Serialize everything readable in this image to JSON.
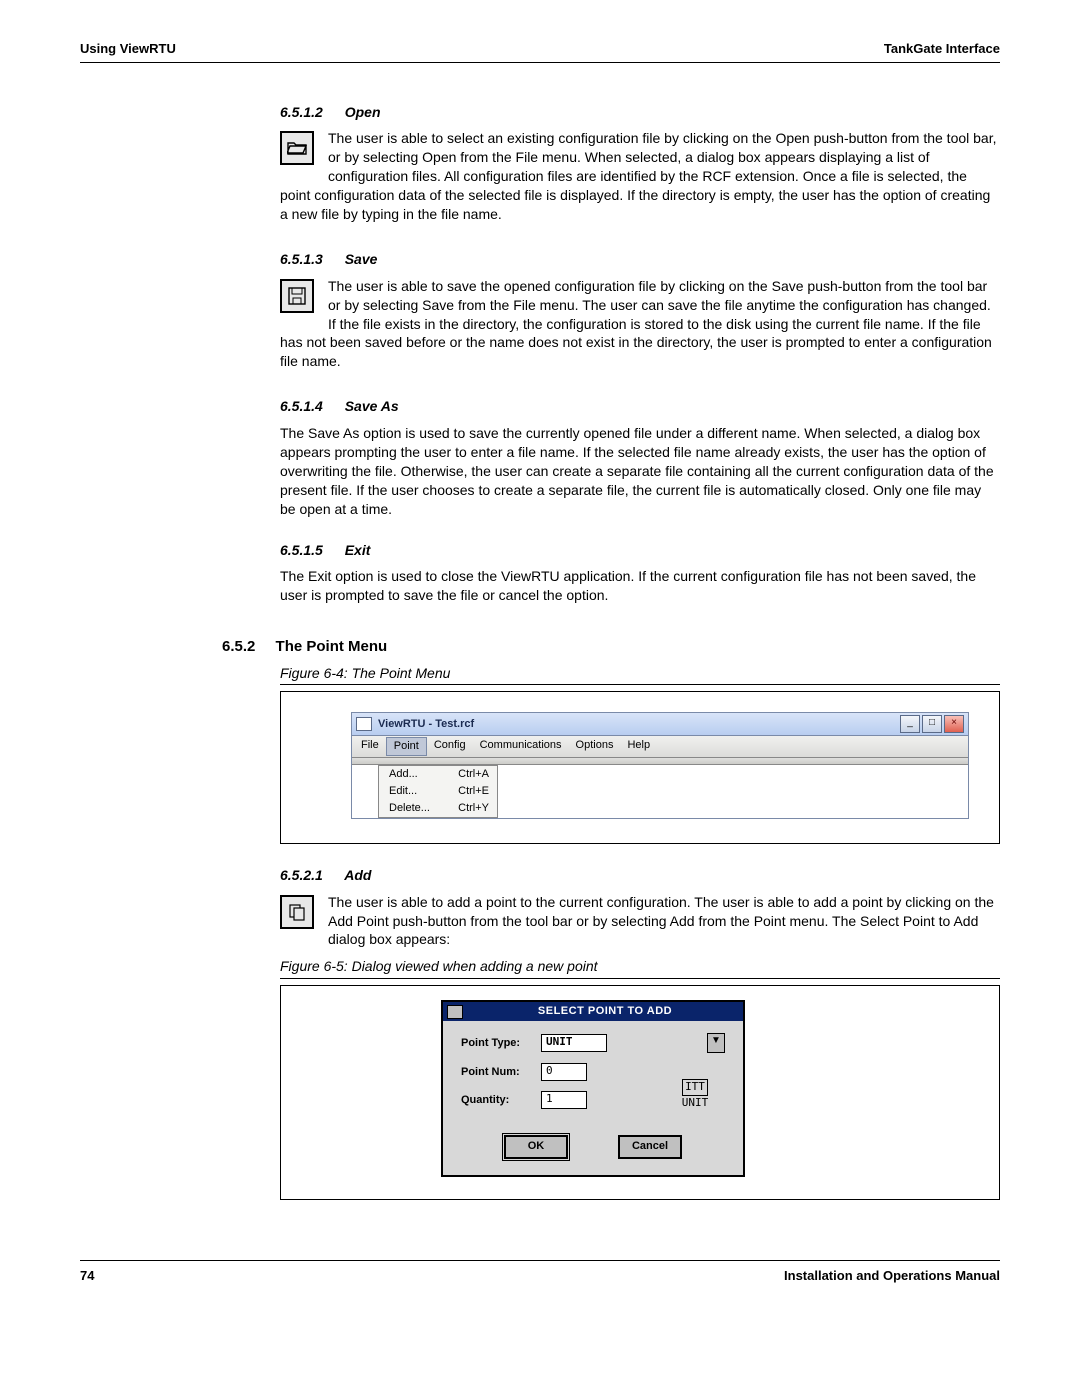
{
  "header": {
    "left": "Using ViewRTU",
    "right": "TankGate Interface"
  },
  "sections": {
    "open": {
      "num": "6.5.1.2",
      "title": "Open",
      "text": "The user is able to select an existing configuration file by clicking on the Open push-button from the tool bar, or by selecting Open from the File menu. When selected, a dialog box appears displaying a list of configuration files. All configuration files are identified by the RCF extension. Once a file is selected, the point configuration data of the selected file is displayed. If the directory is empty, the user has the option of creating a new file by typing in the file name."
    },
    "save": {
      "num": "6.5.1.3",
      "title": "Save",
      "text": "The user is able to save the opened configuration file by clicking on the Save push-button from the tool bar or by selecting Save from the File menu. The user can save the file anytime the configuration has changed. If the file exists in the directory, the configuration is stored to the disk using the current file name. If the file has not been saved before or the name does not exist in the directory, the user is prompted to enter a configuration file name."
    },
    "saveas": {
      "num": "6.5.1.4",
      "title": "Save As",
      "text": "The Save As option is used to save the currently opened file under a different name. When selected, a dialog box appears prompting the user to enter a file name. If the selected file name already exists, the user has the option of overwriting the file. Otherwise, the user can create a separate file containing all the current configuration data of the present file. If the user chooses to create a separate file, the current file is automatically closed. Only one file may be open at a time."
    },
    "exit": {
      "num": "6.5.1.5",
      "title": "Exit",
      "text": "The Exit option is used to close the ViewRTU application. If the current configuration file has not been saved, the user is prompted to save the file or cancel the option."
    },
    "pointmenu": {
      "num": "6.5.2",
      "title": "The Point Menu"
    },
    "add": {
      "num": "6.5.2.1",
      "title": "Add",
      "text": "The user is able to add a point to the current configuration. The user is able to add a point by clicking on the Add Point push-button from the tool bar or by selecting Add from the Point menu. The Select Point to Add dialog box appears:"
    }
  },
  "figures": {
    "f64": "Figure 6-4:  The Point Menu",
    "f65": "Figure 6-5:  Dialog viewed when adding a new point"
  },
  "appwin": {
    "title": "ViewRTU - Test.rcf",
    "menus": [
      "File",
      "Point",
      "Config",
      "Communications",
      "Options",
      "Help"
    ],
    "dropdown": [
      {
        "label": "Add...",
        "accel": "Ctrl+A"
      },
      {
        "label": "Edit...",
        "accel": "Ctrl+E"
      },
      {
        "label": "Delete...",
        "accel": "Ctrl+Y"
      }
    ]
  },
  "dialog": {
    "title": "SELECT POINT TO ADD",
    "fields": {
      "pointtype": {
        "label": "Point Type:",
        "value": "UNIT"
      },
      "pointnum": {
        "label": "Point Num:",
        "value": "0"
      },
      "quantity": {
        "label": "Quantity:",
        "value": "1"
      }
    },
    "itt": {
      "top": "ITT",
      "bottom": "UNIT"
    },
    "ok": "OK",
    "cancel": "Cancel"
  },
  "footer": {
    "page": "74",
    "title": "Installation and Operations Manual"
  }
}
